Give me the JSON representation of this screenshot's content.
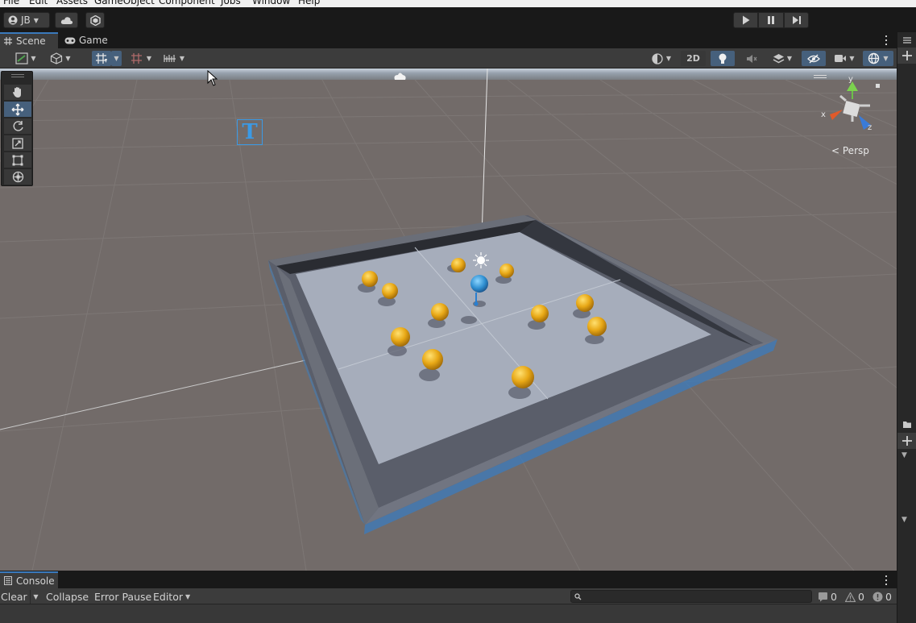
{
  "menu": [
    "File",
    "Edit",
    "Assets",
    "GameObject",
    "Component",
    "Jobs",
    "Window",
    "Help"
  ],
  "toolbar": {
    "account_label": "JB"
  },
  "tabs": {
    "scene": "Scene",
    "game": "Game"
  },
  "scene_toolbar": {
    "toggle_2d": "2D"
  },
  "gizmo": {
    "projection_label": "Persp",
    "axis_x": "x",
    "axis_y": "y",
    "axis_z": "z"
  },
  "viewport": {
    "text_icon": "T"
  },
  "console": {
    "tab_label": "Console",
    "clear": "Clear",
    "collapse": "Collapse",
    "error_pause": "Error Pause",
    "editor": "Editor",
    "log_count": "0",
    "warning_count": "0",
    "error_count": "0"
  }
}
